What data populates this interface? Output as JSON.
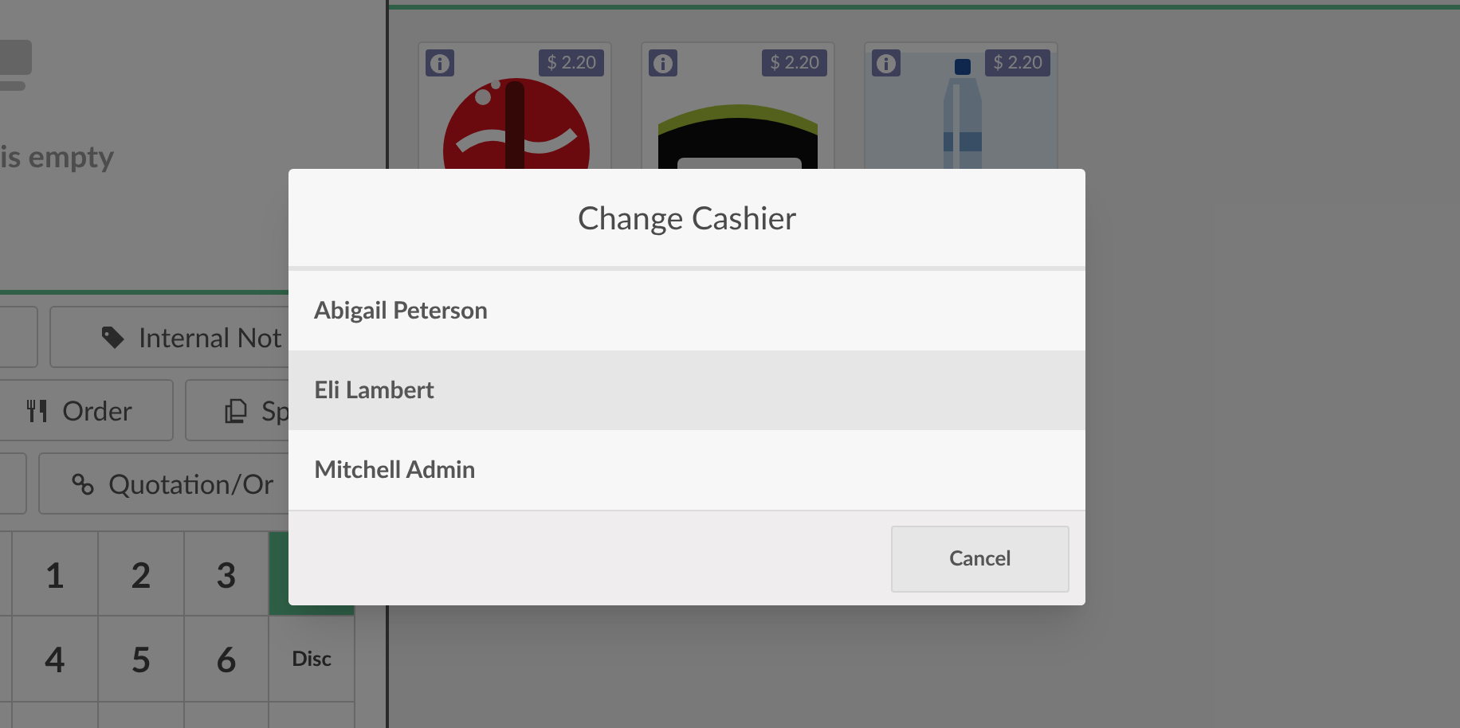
{
  "cart": {
    "empty_text": "is empty"
  },
  "control_rows": [
    {
      "buttons": [
        {
          "kind": "blank"
        },
        {
          "kind": "tag",
          "label": "Internal Not"
        }
      ]
    },
    {
      "buttons": [
        {
          "kind": "utensils",
          "label": "Order"
        },
        {
          "kind": "split",
          "label": "Sp"
        }
      ]
    },
    {
      "buttons": [
        {
          "kind": "blank"
        },
        {
          "kind": "link",
          "label": "Quotation/Or"
        }
      ]
    }
  ],
  "numpad": [
    [
      {
        "kind": "blank",
        "selected": false
      },
      {
        "kind": "digit",
        "label": "1",
        "selected": false
      },
      {
        "kind": "digit",
        "label": "2",
        "selected": false
      },
      {
        "kind": "digit",
        "label": "3",
        "selected": false
      },
      {
        "kind": "blank",
        "selected": true
      }
    ],
    [
      {
        "kind": "blank",
        "selected": false
      },
      {
        "kind": "digit",
        "label": "4",
        "selected": false
      },
      {
        "kind": "digit",
        "label": "5",
        "selected": false
      },
      {
        "kind": "digit",
        "label": "6",
        "selected": false
      },
      {
        "kind": "mode",
        "label": "Disc",
        "selected": false
      }
    ],
    [
      {
        "kind": "blank",
        "selected": false
      },
      {
        "kind": "blank",
        "selected": false
      },
      {
        "kind": "blank",
        "selected": false
      },
      {
        "kind": "blank",
        "selected": false
      },
      {
        "kind": "blank",
        "selected": false
      }
    ]
  ],
  "products": [
    {
      "kind": "picture",
      "price": "$ 2.20"
    },
    {
      "kind": "picture",
      "price": "$ 2.20"
    },
    {
      "kind": "picture",
      "price": "$ 2.20"
    }
  ],
  "dialog": {
    "title": "Change Cashier",
    "cashiers": [
      {
        "name": "Abigail Peterson",
        "selected": false
      },
      {
        "name": "Eli Lambert",
        "selected": true
      },
      {
        "name": "Mitchell Admin",
        "selected": false
      }
    ],
    "buttons": [
      "Cancel"
    ]
  }
}
